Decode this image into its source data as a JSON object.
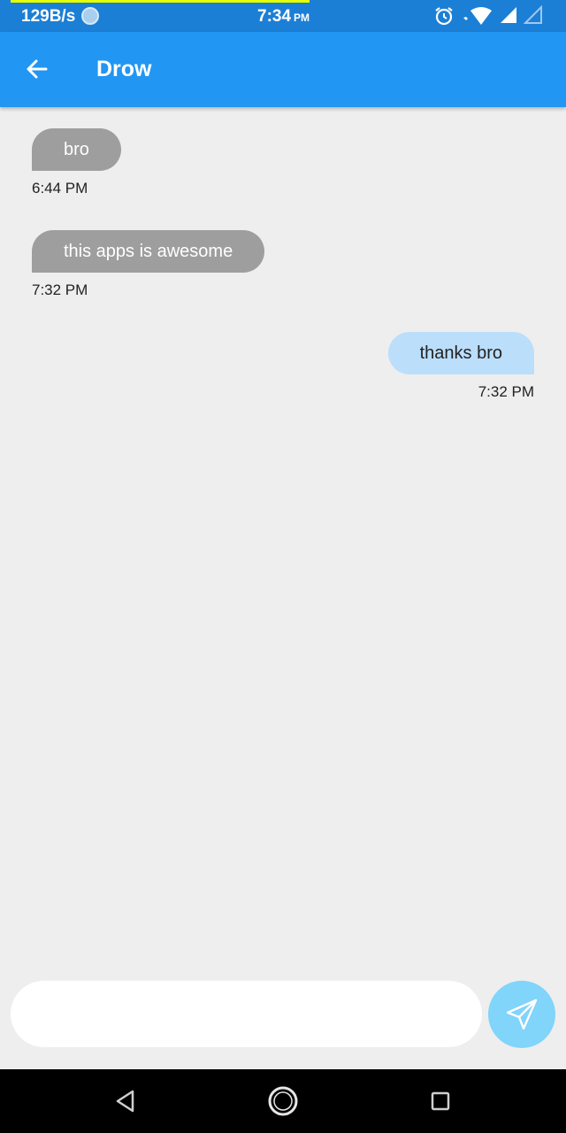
{
  "status_bar": {
    "net_speed": "129B/s",
    "time": "7:34",
    "ampm": "PM",
    "icons": [
      "sync-icon",
      "alarm-icon",
      "wifi-icon",
      "signal-icon",
      "signal-empty-icon"
    ]
  },
  "app_bar": {
    "title": "Drow",
    "back_icon": "arrow-left-icon"
  },
  "messages": [
    {
      "direction": "received",
      "text": "bro",
      "time": "6:44 PM"
    },
    {
      "direction": "received",
      "text": "this apps is awesome",
      "time": "7:32 PM"
    },
    {
      "direction": "sent",
      "text": "thanks bro",
      "time": "7:32 PM"
    }
  ],
  "composer": {
    "input_value": "",
    "placeholder": "",
    "send_icon": "send-icon"
  },
  "nav_bar": {
    "icons": [
      "back-triangle-icon",
      "home-circle-icon",
      "recents-square-icon"
    ]
  },
  "colors": {
    "status_bar": "#1c7fd6",
    "app_bar": "#2196f3",
    "received_bubble": "#9e9e9e",
    "sent_bubble": "#bbdefb",
    "send_button": "#81d4fa",
    "background": "#eeeeee"
  }
}
